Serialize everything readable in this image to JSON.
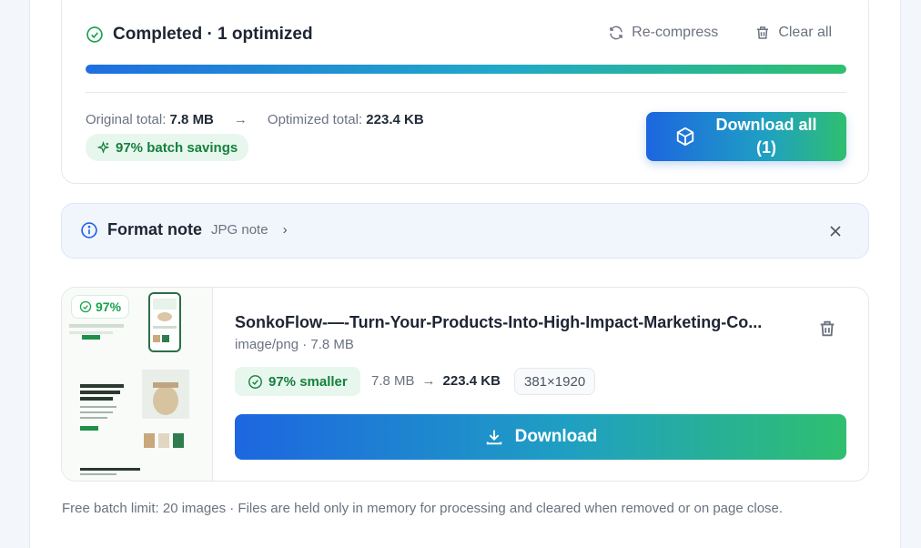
{
  "summary": {
    "status": "Completed · 1 optimized",
    "recompress_label": "Re-compress",
    "clear_label": "Clear all",
    "progress": 1.0,
    "original_label": "Original total:",
    "original_value": "7.8 MB",
    "optimized_label": "Optimized total:",
    "optimized_value": "223.4 KB",
    "savings": "97% batch savings",
    "download_all_line1": "Download all",
    "download_all_line2": "(1)"
  },
  "note": {
    "title": "Format note",
    "subtitle": "JPG note"
  },
  "file": {
    "thumb_badge": "97%",
    "name": "SonkoFlow-—-Turn-Your-Products-Into-High-Impact-Marketing-Co...",
    "meta": "image/png · 7.8 MB",
    "smaller": "97% smaller",
    "original_size": "7.8 MB",
    "optimized_size": "223.4 KB",
    "dimensions": "381×1920",
    "download_label": "Download"
  },
  "footer": "Free batch limit: 20 images · Files are held only in memory for processing and cleared when removed or on page close.",
  "colors": {
    "accent_blue": "#1d66e0",
    "accent_green": "#2fbf6f",
    "success": "#16a34a"
  }
}
